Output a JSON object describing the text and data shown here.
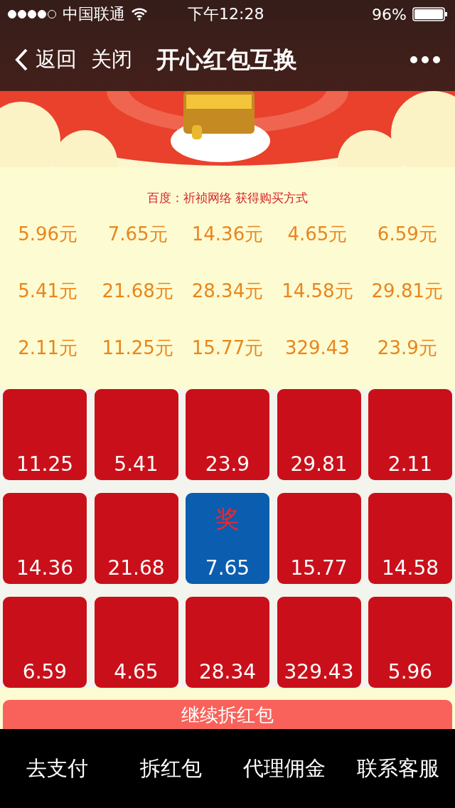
{
  "status_bar": {
    "carrier": "中国联通",
    "time": "下午12:28",
    "battery": "96%"
  },
  "nav": {
    "back": "返回",
    "close": "关闭",
    "title": "开心红包互换"
  },
  "caption": "百度：祈祯网络 获得购买方式",
  "amounts": [
    "5.96元",
    "7.65元",
    "14.36元",
    "4.65元",
    "6.59元",
    "5.41元",
    "21.68元",
    "28.34元",
    "14.58元",
    "29.81元",
    "2.11元",
    "11.25元",
    "15.77元",
    "329.43",
    "23.9元"
  ],
  "envelopes": [
    {
      "value": "11.25",
      "selected": false
    },
    {
      "value": "5.41",
      "selected": false
    },
    {
      "value": "23.9",
      "selected": false
    },
    {
      "value": "29.81",
      "selected": false
    },
    {
      "value": "2.11",
      "selected": false
    },
    {
      "value": "14.36",
      "selected": false
    },
    {
      "value": "21.68",
      "selected": false
    },
    {
      "value": "7.65",
      "selected": true,
      "badge": "奖"
    },
    {
      "value": "15.77",
      "selected": false
    },
    {
      "value": "14.58",
      "selected": false
    },
    {
      "value": "6.59",
      "selected": false
    },
    {
      "value": "4.65",
      "selected": false
    },
    {
      "value": "28.34",
      "selected": false
    },
    {
      "value": "329.43",
      "selected": false
    },
    {
      "value": "5.96",
      "selected": false
    }
  ],
  "continue_button": "继续拆红包",
  "bottom_tabs": [
    "去支付",
    "拆红包",
    "代理佣金",
    "联系客服"
  ]
}
